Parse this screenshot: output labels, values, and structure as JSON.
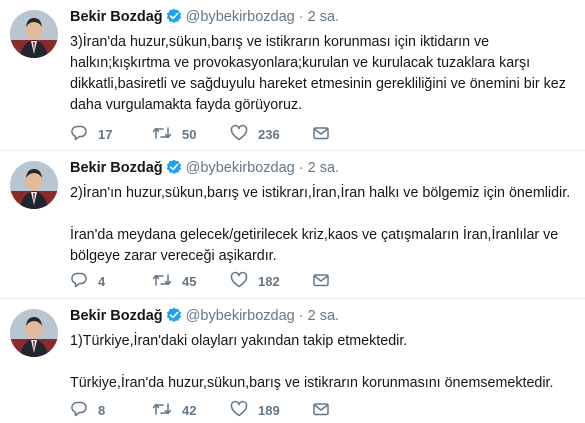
{
  "tweets": [
    {
      "name": "Bekir Bozdağ",
      "handle": "@bybekirbozdag",
      "separator": "·",
      "time": "2 sa.",
      "text": "3)İran'da huzur,sükun,barış ve istikrarın korunması için iktidarın ve halkın;kışkırtma ve provokasyonlara;kurulan ve kurulacak tuzaklara karşı dikkatli,basiretli ve sağduyulu hareket etmesinin gerekliliğini ve önemini bir kez daha vurgulamakta fayda görüyoruz.",
      "replies": "17",
      "retweets": "50",
      "likes": "236"
    },
    {
      "name": "Bekir Bozdağ",
      "handle": "@bybekirbozdag",
      "separator": "·",
      "time": "2 sa.",
      "text": "2)İran'ın huzur,sükun,barış ve istikrarı,İran,İran halkı ve bölgemiz için önemlidir.\n\nİran'da meydana gelecek/getirilecek kriz,kaos ve çatışmaların İran,İranlılar ve bölgeye zarar vereceği aşikardır.",
      "replies": "4",
      "retweets": "45",
      "likes": "182"
    },
    {
      "name": "Bekir Bozdağ",
      "handle": "@bybekirbozdag",
      "separator": "·",
      "time": "2 sa.",
      "text": "1)Türkiye,İran'daki olayları yakından takip etmektedir.\n\nTürkiye,İran'da huzur,sükun,barış ve istikrarın korunmasını önemsemektedir.",
      "replies": "8",
      "retweets": "42",
      "likes": "189"
    }
  ],
  "icons": {
    "verified": "verified-badge-icon",
    "reply": "reply-icon",
    "retweet": "retweet-icon",
    "like": "heart-icon",
    "message": "envelope-icon"
  },
  "colors": {
    "verified": "#1da1f2",
    "icon": "#657786",
    "divider": "#e6ecf0"
  }
}
